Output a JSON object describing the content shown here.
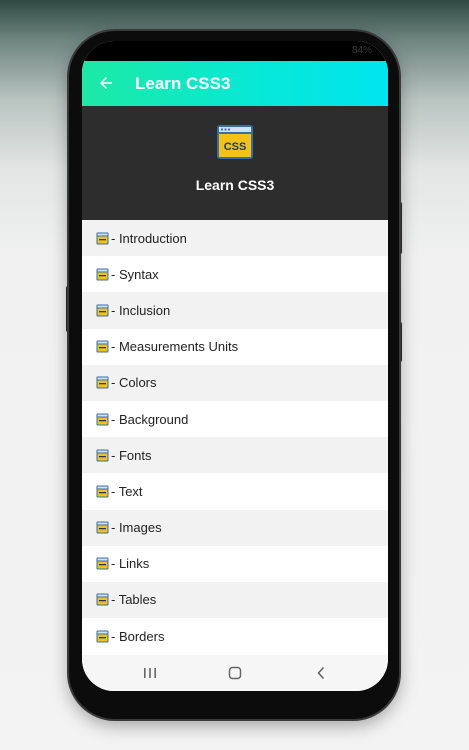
{
  "status_bar": {
    "battery_text": "84%"
  },
  "app_bar": {
    "title": "Learn CSS3",
    "back_icon": "arrow-left-icon"
  },
  "header": {
    "title": "Learn CSS3",
    "logo_text": "CSS",
    "logo_icon": "css-browser-window-icon"
  },
  "list": {
    "items": [
      {
        "label": "- Introduction"
      },
      {
        "label": "- Syntax"
      },
      {
        "label": "- Inclusion"
      },
      {
        "label": "- Measurements Units"
      },
      {
        "label": "- Colors"
      },
      {
        "label": "- Background"
      },
      {
        "label": "- Fonts"
      },
      {
        "label": "- Text"
      },
      {
        "label": "- Images"
      },
      {
        "label": "- Links"
      },
      {
        "label": "- Tables"
      },
      {
        "label": "- Borders"
      }
    ]
  },
  "nav_bar": {
    "recent_icon": "recent-apps-icon",
    "home_icon": "home-icon",
    "back_icon": "back-chevron-icon"
  },
  "colors": {
    "app_bar_start": "#1de9a5",
    "app_bar_end": "#00e5f0",
    "header_bg": "#2d2d2d",
    "logo_yellow": "#f2c21b",
    "logo_blue": "#3b6ea5"
  }
}
